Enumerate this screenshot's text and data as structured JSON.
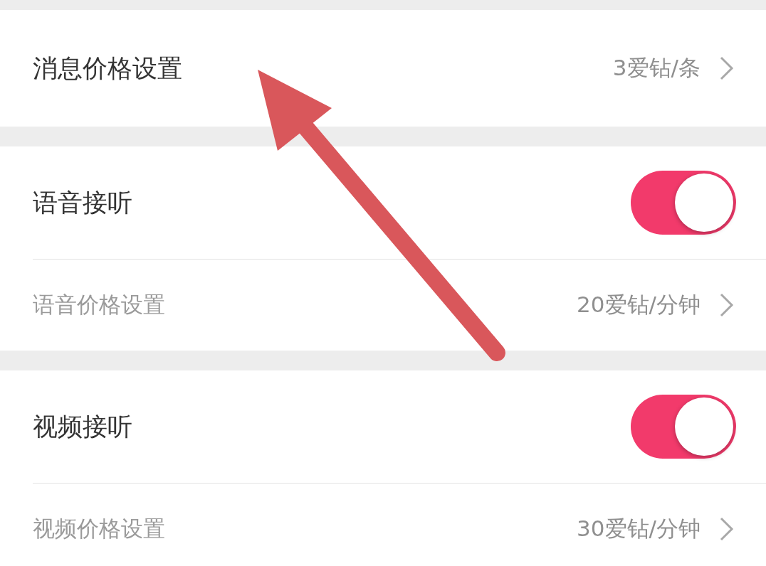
{
  "sections": [
    {
      "rows": [
        {
          "kind": "link",
          "label": "消息价格设置",
          "value": "3爱钻/条"
        }
      ]
    },
    {
      "rows": [
        {
          "kind": "toggle",
          "label": "语音接听",
          "on": true
        },
        {
          "kind": "sublink",
          "label": "语音价格设置",
          "value": "20爱钻/分钟"
        }
      ]
    },
    {
      "rows": [
        {
          "kind": "toggle",
          "label": "视频接听",
          "on": true
        },
        {
          "kind": "sublink",
          "label": "视频价格设置",
          "value": "30爱钻/分钟"
        }
      ]
    }
  ]
}
